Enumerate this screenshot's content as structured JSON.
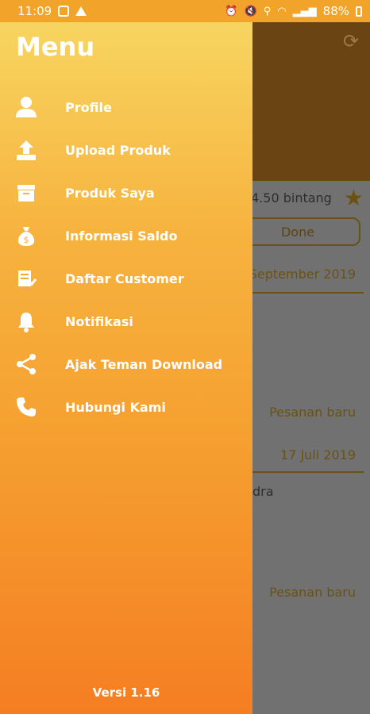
{
  "status_bar": {
    "time": "11:09",
    "battery": "88%"
  },
  "background": {
    "rating": "4.50 bintang",
    "done_button": "Done",
    "date1": "September 2019",
    "status1": "Pesanan baru",
    "date2": "17 Juli 2019",
    "name": "dra",
    "status2": "Pesanan baru"
  },
  "drawer": {
    "title": "Menu",
    "items": [
      {
        "label": "Profile",
        "icon": "user-icon"
      },
      {
        "label": "Upload Produk",
        "icon": "upload-icon"
      },
      {
        "label": "Produk Saya",
        "icon": "archive-box-icon"
      },
      {
        "label": "Informasi Saldo",
        "icon": "money-bag-icon"
      },
      {
        "label": "Daftar Customer",
        "icon": "customer-list-icon"
      },
      {
        "label": "Notifikasi",
        "icon": "bell-icon"
      },
      {
        "label": "Ajak Teman Download",
        "icon": "share-icon"
      },
      {
        "label": "Hubungi Kami",
        "icon": "phone-icon"
      }
    ],
    "version": "Versi 1.16"
  },
  "colors": {
    "drawer_top": "#f7d560",
    "drawer_bottom": "#f57e22",
    "header_dim": "#6a4413"
  }
}
